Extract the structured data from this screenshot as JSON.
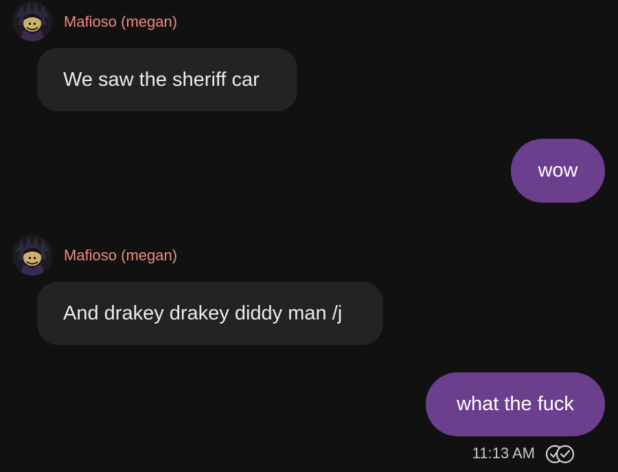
{
  "messages": [
    {
      "direction": "incoming",
      "sender": "Mafioso (megan)",
      "text": "We saw the sheriff car"
    },
    {
      "direction": "outgoing",
      "text": "wow"
    },
    {
      "direction": "incoming",
      "sender": "Mafioso (megan)",
      "text": "And drakey drakey diddy man /j"
    },
    {
      "direction": "outgoing",
      "text": "what the fuck"
    }
  ],
  "last_message_meta": {
    "time": "11:13 AM",
    "status_icon": "double-check-icon"
  },
  "colors": {
    "background": "#111111",
    "incoming_bubble": "#232325",
    "outgoing_bubble": "#6b3e8e",
    "sender_name": "#f08a80"
  }
}
